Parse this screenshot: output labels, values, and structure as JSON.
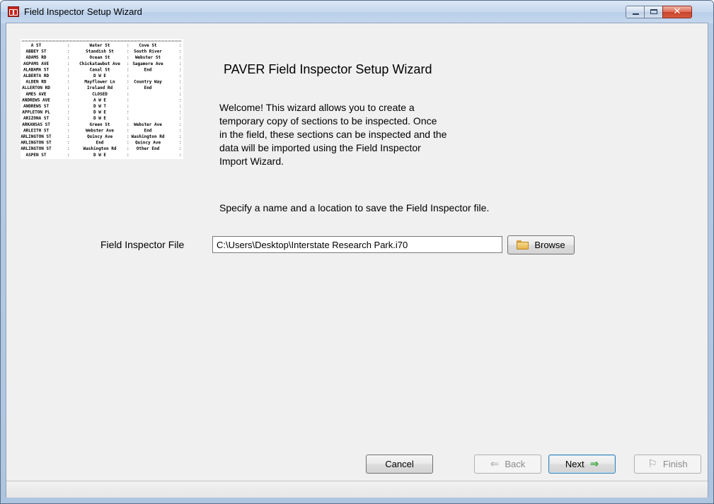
{
  "window": {
    "title": "Field Inspector Setup Wizard",
    "icons": {
      "app": "paver-app-icon",
      "minimize": "minimize-icon",
      "maximize": "maximize-icon",
      "close": "close-icon"
    }
  },
  "thumbnail": {
    "description_icon": "street-list-thumbnail",
    "rows": [
      [
        "A ST",
        "Water St",
        "Cove St"
      ],
      [
        "ABBEY ST",
        "Standish St",
        "South River"
      ],
      [
        "ADAMS RD",
        "Ocean St",
        "Webster St"
      ],
      [
        "AGPAMS AVE",
        "Chickatawbut Ave",
        "Sagamore Ave"
      ],
      [
        "ALABAMA ST",
        "Canal St",
        "End"
      ],
      [
        "ALBERTA RD",
        "D W E",
        ""
      ],
      [
        "ALDEN RD",
        "Mayflower Ln",
        "Country Way"
      ],
      [
        "ALLERTON RD",
        "Ireland Rd",
        "End"
      ],
      [
        "AMES AVE",
        "CLOSED",
        ""
      ],
      [
        "ANDREWS AVE",
        "A W E",
        ""
      ],
      [
        "ANDREWS ST",
        "D W T",
        ""
      ],
      [
        "APPLETON PL",
        "D W E",
        ""
      ],
      [
        "ARIZONA ST",
        "D W E",
        ""
      ],
      [
        "ARKANSAS ST",
        "Green St",
        "Webster Ave"
      ],
      [
        "ARLEITH ST",
        "Webster Ave",
        "End"
      ],
      [
        "ARLINGTON ST",
        "Quincy Ave",
        "Washington Rd"
      ],
      [
        "ARLINGTON ST",
        "End",
        "Quincy Ave"
      ],
      [
        "ARLINGTON ST",
        "Washington Rd",
        "Other End"
      ],
      [
        "ASPEN ST",
        "D W E",
        ""
      ]
    ]
  },
  "heading": "PAVER Field Inspector Setup Wizard",
  "welcome_text": "Welcome!  This wizard allows you to create a\ntemporary copy of sections to be inspected.  Once\nin the field, these sections can be inspected and the\ndata will be imported using the Field Inspector\nImport Wizard.",
  "instruction": "Specify a name and a location to save the Field Inspector file.",
  "file_field": {
    "label": "Field Inspector File",
    "value": "C:\\Users\\Desktop\\Interstate Research Park.i70",
    "browse_label": "Browse",
    "browse_icon": "folder-icon"
  },
  "buttons": {
    "cancel": "Cancel",
    "back": "Back",
    "next": "Next",
    "finish": "Finish",
    "back_icon": "arrow-left-icon",
    "next_icon": "arrow-right-icon",
    "finish_icon": "flag-icon",
    "back_enabled": false,
    "finish_enabled": false
  }
}
